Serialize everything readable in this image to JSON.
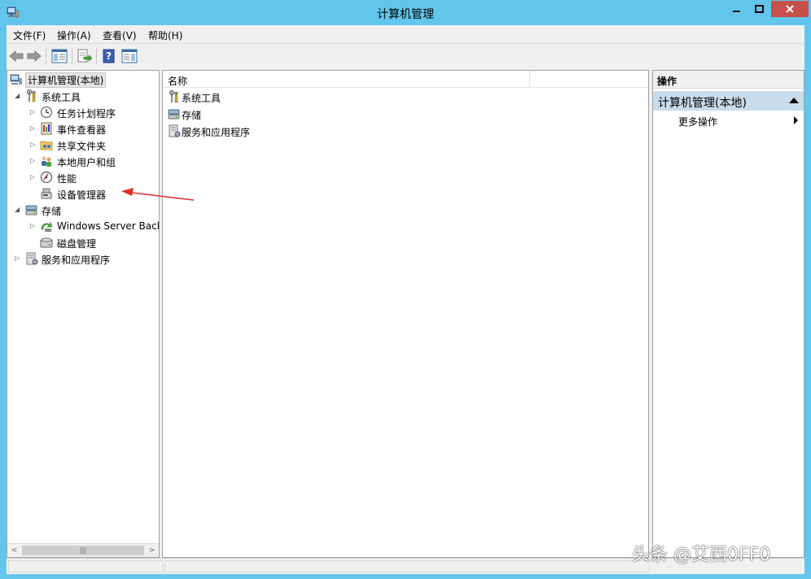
{
  "window": {
    "title": "计算机管理",
    "controls": {
      "minimize": "minimize",
      "maximize": "maximize",
      "close": "close"
    },
    "accent_color": "#62c6ec"
  },
  "menu": {
    "file": "文件(F)",
    "action": "操作(A)",
    "view": "查看(V)",
    "help": "帮助(H)"
  },
  "toolbar": {
    "buttons": [
      "back-arrow-icon",
      "forward-arrow-icon",
      "show-hide-tree-icon",
      "export-list-icon",
      "help-icon",
      "show-hide-action-pane-icon"
    ]
  },
  "tree": {
    "root": "计算机管理(本地)",
    "system_tools": "系统工具",
    "task_scheduler": "任务计划程序",
    "event_viewer": "事件查看器",
    "shared_folders": "共享文件夹",
    "local_users": "本地用户和组",
    "performance": "性能",
    "device_manager": "设备管理器",
    "storage": "存储",
    "windows_backup": "Windows Server Backup",
    "disk_management": "磁盘管理",
    "services_apps": "服务和应用程序"
  },
  "list": {
    "column_name": "名称",
    "items": [
      "系统工具",
      "存储",
      "服务和应用程序"
    ]
  },
  "actions": {
    "header": "操作",
    "group": "计算机管理(本地)",
    "more_actions": "更多操作"
  },
  "annotation": {
    "color": "#e0302a"
  },
  "watermark": "头条 @艾西0FF0"
}
